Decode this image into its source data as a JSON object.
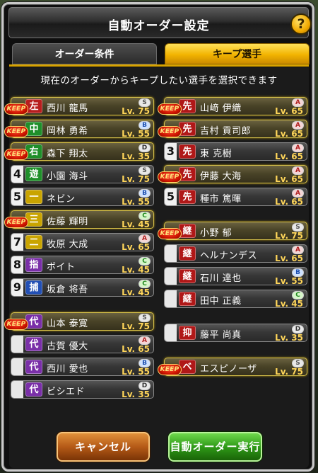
{
  "colors": {
    "pos_red": "#b81e1e",
    "pos_green": "#1f8f2a",
    "pos_yellow": "#c9a400",
    "pos_purple": "#7a2fa8",
    "pos_blue": "#2350b5",
    "pos_darkred": "#b01818",
    "rank_S": "#e8e8e8",
    "rank_A": "#f4d6d6",
    "rank_B": "#cfe2ff",
    "rank_C": "#d6f5c9",
    "rank_D": "#eaeaea",
    "accent_gold": "#f2b300"
  },
  "header": {
    "title": "自動オーダー設定",
    "help_label": "?",
    "help_icon": "question-mark-icon"
  },
  "tabs": [
    {
      "label": "オーダー条件",
      "active": false
    },
    {
      "label": "キープ選手",
      "active": true
    }
  ],
  "instruction": "現在のオーダーからキープしたい選手を選択できます",
  "keep_badge_label": "KEEP",
  "left_column": [
    {
      "order": "",
      "pos": "左",
      "pos_color": "red",
      "name": "西川 龍馬",
      "rank": "S",
      "level": "Lv. 75",
      "keep": true
    },
    {
      "order": "",
      "pos": "中",
      "pos_color": "green",
      "name": "岡林 勇希",
      "rank": "B",
      "level": "Lv. 55",
      "keep": true
    },
    {
      "order": "",
      "pos": "右",
      "pos_color": "green",
      "name": "森下 翔太",
      "rank": "D",
      "level": "Lv. 35",
      "keep": true
    },
    {
      "order": "4",
      "pos": "遊",
      "pos_color": "green",
      "name": "小園 海斗",
      "rank": "S",
      "level": "Lv. 75",
      "keep": false
    },
    {
      "order": "5",
      "pos": "一",
      "pos_color": "yellow",
      "name": "ネビン",
      "rank": "B",
      "level": "Lv. 55",
      "keep": false
    },
    {
      "order": "",
      "pos": "三",
      "pos_color": "yellow",
      "name": "佐藤 輝明",
      "rank": "C",
      "level": "Lv. 45",
      "keep": true
    },
    {
      "order": "7",
      "pos": "二",
      "pos_color": "yellow",
      "name": "牧原 大成",
      "rank": "A",
      "level": "Lv. 65",
      "keep": false
    },
    {
      "order": "8",
      "pos": "指",
      "pos_color": "purple",
      "name": "ボイト",
      "rank": "C",
      "level": "Lv. 45",
      "keep": false
    },
    {
      "order": "9",
      "pos": "捕",
      "pos_color": "blue",
      "name": "坂倉 将吾",
      "rank": "C",
      "level": "Lv. 45",
      "keep": false
    },
    {
      "order": "",
      "pos": "代",
      "pos_color": "purple",
      "name": "山本 泰寛",
      "rank": "S",
      "level": "Lv. 75",
      "keep": true
    },
    {
      "order": "blank",
      "pos": "代",
      "pos_color": "purple",
      "name": "古賀 優大",
      "rank": "A",
      "level": "Lv. 65",
      "keep": false
    },
    {
      "order": "blank",
      "pos": "代",
      "pos_color": "purple",
      "name": "西川 愛也",
      "rank": "B",
      "level": "Lv. 55",
      "keep": false
    },
    {
      "order": "blank",
      "pos": "代",
      "pos_color": "purple",
      "name": "ビシエド",
      "rank": "D",
      "level": "Lv. 35",
      "keep": false
    }
  ],
  "right_column": [
    {
      "order": "",
      "pos": "先",
      "pos_color": "darkred",
      "name": "山﨑 伊織",
      "rank": "A",
      "level": "Lv. 65",
      "keep": true
    },
    {
      "order": "",
      "pos": "先",
      "pos_color": "darkred",
      "name": "吉村 貢司郎",
      "rank": "A",
      "level": "Lv. 65",
      "keep": true
    },
    {
      "order": "3",
      "pos": "先",
      "pos_color": "darkred",
      "name": "東 克樹",
      "rank": "A",
      "level": "Lv. 65",
      "keep": false
    },
    {
      "order": "",
      "pos": "先",
      "pos_color": "darkred",
      "name": "伊藤 大海",
      "rank": "A",
      "level": "Lv. 65",
      "keep": true
    },
    {
      "order": "5",
      "pos": "先",
      "pos_color": "darkred",
      "name": "種市 篤暉",
      "rank": "A",
      "level": "Lv. 65",
      "keep": false
    },
    {
      "order": "",
      "pos": "継",
      "pos_color": "darkred",
      "name": "小野 郁",
      "rank": "S",
      "level": "Lv. 75",
      "keep": true
    },
    {
      "order": "blank",
      "pos": "継",
      "pos_color": "darkred",
      "name": "ヘルナンデス",
      "rank": "A",
      "level": "Lv. 65",
      "keep": false
    },
    {
      "order": "blank",
      "pos": "継",
      "pos_color": "darkred",
      "name": "石川 達也",
      "rank": "B",
      "level": "Lv. 55",
      "keep": false
    },
    {
      "order": "blank",
      "pos": "継",
      "pos_color": "darkred",
      "name": "田中 正義",
      "rank": "C",
      "level": "Lv. 45",
      "keep": false
    },
    {
      "order": "blank",
      "pos": "抑",
      "pos_color": "darkred",
      "name": "藤平 尚真",
      "rank": "D",
      "level": "Lv. 35",
      "keep": false
    },
    {
      "order": "",
      "pos": "ベ",
      "pos_color": "darkred",
      "name": "エスピノーザ",
      "rank": "S",
      "level": "Lv. 75",
      "keep": true
    }
  ],
  "buttons": {
    "cancel": "キャンセル",
    "execute": "自動オーダー実行"
  }
}
